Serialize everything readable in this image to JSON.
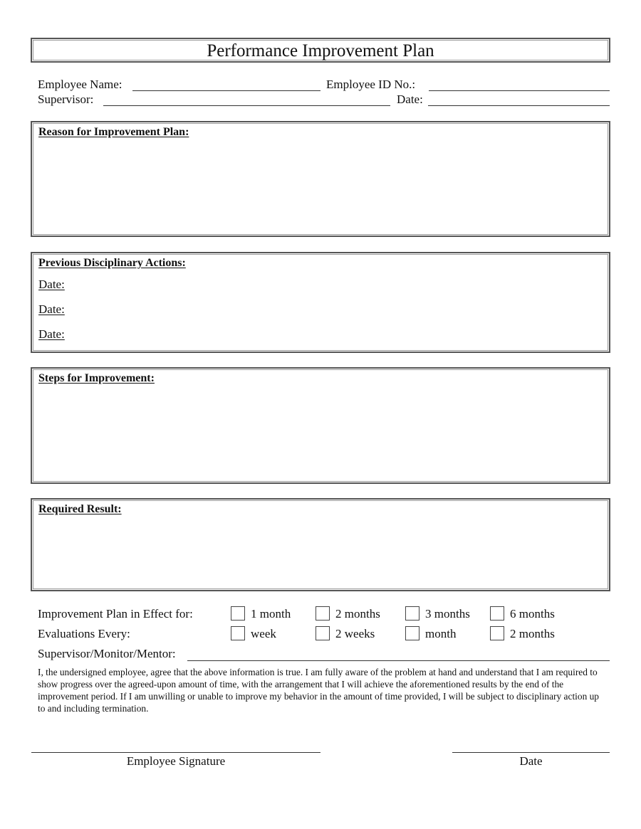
{
  "document": {
    "title": "Performance Improvement Plan"
  },
  "header_fields": {
    "employee_name_label": "Employee Name:",
    "employee_name_value": "",
    "employee_id_label": "Employee ID No.:",
    "employee_id_value": "",
    "supervisor_label": "Supervisor:",
    "supervisor_value": "",
    "date_label": "Date:",
    "date_value": ""
  },
  "sections": {
    "reason": {
      "title": "Reason for Improvement Plan:",
      "content": ""
    },
    "previous_actions": {
      "title": "Previous Disciplinary Actions:",
      "date_labels": [
        "Date:",
        "Date:",
        "Date:"
      ]
    },
    "steps": {
      "title": "Steps for Improvement:",
      "content": ""
    },
    "required_result": {
      "title": "Required Result:",
      "content": ""
    }
  },
  "plan_duration": {
    "label": "Improvement Plan in Effect for:",
    "options": [
      {
        "label": "1 month",
        "checked": false
      },
      {
        "label": "2 months",
        "checked": false
      },
      {
        "label": "3 months",
        "checked": false
      },
      {
        "label": "6 months",
        "checked": false
      }
    ]
  },
  "evaluations": {
    "label": "Evaluations Every:",
    "options": [
      {
        "label": "week",
        "checked": false
      },
      {
        "label": "2 weeks",
        "checked": false
      },
      {
        "label": "month",
        "checked": false
      },
      {
        "label": "2 months",
        "checked": false
      }
    ]
  },
  "mentor": {
    "label": "Supervisor/Monitor/Mentor:",
    "value": ""
  },
  "agreement_text": "I, the undersigned employee, agree that the above information is true. I am fully aware of the problem at hand and understand that I am required to show progress over the agreed-upon amount of time, with the arrangement that I will achieve the aforementioned results by the end of the improvement period. If I am unwilling or unable to improve my behavior in the amount of time provided, I will be subject to disciplinary action up to and including termination.",
  "signatures": {
    "employee_signature_label": "Employee Signature",
    "date_label": "Date"
  }
}
